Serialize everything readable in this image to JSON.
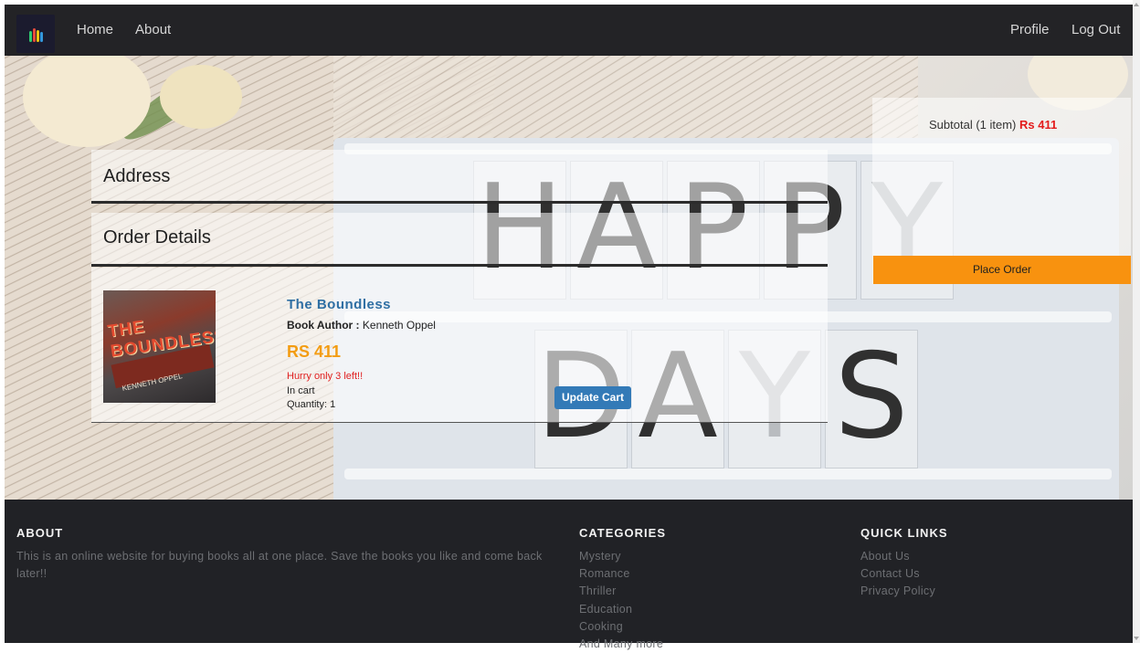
{
  "nav": {
    "home": "Home",
    "about": "About",
    "profile": "Profile",
    "logout": "Log Out"
  },
  "hero": {
    "letters_top": [
      "H",
      "A",
      "P",
      "P",
      "Y"
    ],
    "letters_bottom": [
      "D",
      "A",
      "Y",
      "S"
    ]
  },
  "address": {
    "title": "Address"
  },
  "order": {
    "title": "Order Details",
    "item": {
      "cover_title": "THE BOUNDLESS",
      "cover_author": "KENNETH OPPEL",
      "title": "The Boundless",
      "author_label": "Book Author :",
      "author": "Kenneth Oppel",
      "price": "RS 411",
      "stock": "Hurry only 3 left!!",
      "status": "In cart",
      "quantity": "Quantity: 1",
      "update_label": "Update Cart"
    }
  },
  "summary": {
    "subtotal_label": "Subtotal (1 item)",
    "subtotal_amount": "Rs 411",
    "place_order_label": "Place Order"
  },
  "footer": {
    "about_title": "ABOUT",
    "about_text": "This is an online website for buying books all at one place. Save the books you like and come back later!!",
    "categories_title": "CATEGORIES",
    "categories": [
      "Mystery",
      "Romance",
      "Thriller",
      "Education",
      "Cooking",
      "And Many more"
    ],
    "links_title": "QUICK LINKS",
    "links": [
      "About Us",
      "Contact Us",
      "Privacy Policy"
    ]
  },
  "colors": {
    "navbar": "#232326",
    "footer": "#212226",
    "accent_orange": "#f8920f",
    "price_orange": "#f39c12",
    "link_blue": "#2f6fa3",
    "button_blue": "#337ab7",
    "alert_red": "#e31b1b"
  },
  "icons": {
    "logo": "color-bars-logo-icon"
  }
}
